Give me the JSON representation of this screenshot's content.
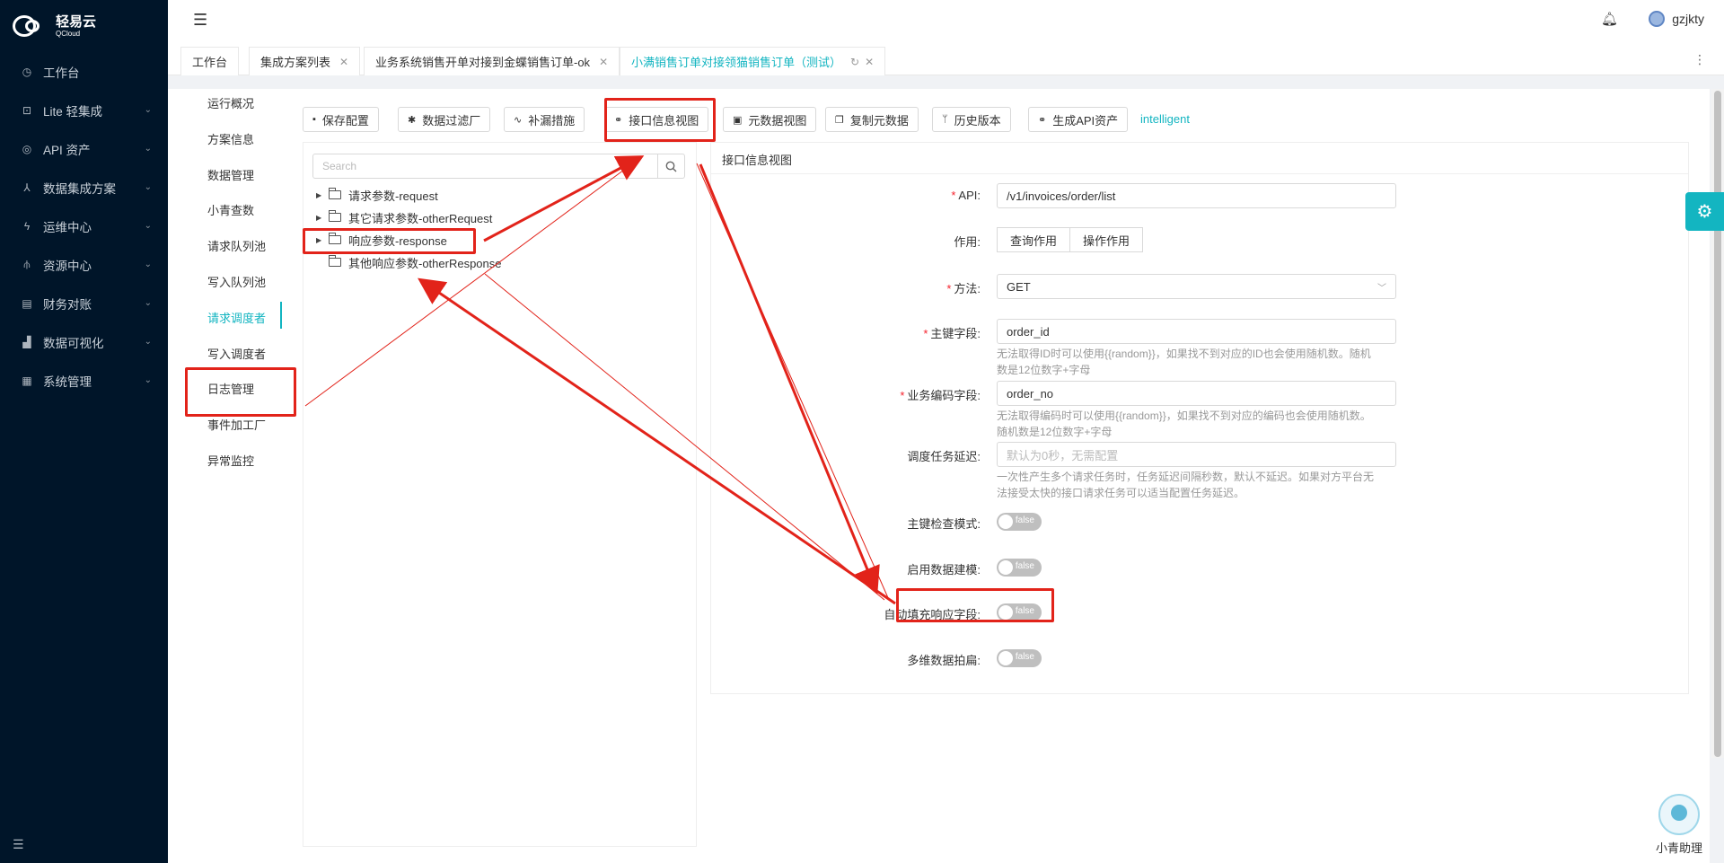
{
  "brand": {
    "name_cn": "轻易云",
    "name_en": "QCloud"
  },
  "sidebar": {
    "items": [
      {
        "label": "工作台",
        "icon": "clock-icon",
        "has_children": false
      },
      {
        "label": "Lite 轻集成",
        "icon": "lite-icon",
        "has_children": true
      },
      {
        "label": "API 资产",
        "icon": "compass-icon",
        "has_children": true
      },
      {
        "label": "数据集成方案",
        "icon": "flow-icon",
        "has_children": true
      },
      {
        "label": "运维中心",
        "icon": "bolt-icon",
        "has_children": true
      },
      {
        "label": "资源中心",
        "icon": "tree-icon",
        "has_children": true
      },
      {
        "label": "财务对账",
        "icon": "ledger-icon",
        "has_children": true
      },
      {
        "label": "数据可视化",
        "icon": "chart-icon",
        "has_children": true
      },
      {
        "label": "系统管理",
        "icon": "grid-icon",
        "has_children": true
      }
    ]
  },
  "header": {
    "username": "gzjkty"
  },
  "tabs": [
    {
      "label": "工作台",
      "closable": false,
      "active": false
    },
    {
      "label": "集成方案列表",
      "closable": true,
      "active": false
    },
    {
      "label": "业务系统销售开单对接到金蝶销售订单-ok",
      "closable": true,
      "active": false
    },
    {
      "label": "小满销售订单对接领猫销售订单（测试）",
      "closable": true,
      "active": true
    }
  ],
  "submenu": {
    "items": [
      "运行概况",
      "方案信息",
      "数据管理",
      "小青查数",
      "请求队列池",
      "写入队列池",
      "请求调度者",
      "写入调度者",
      "日志管理",
      "事件加工厂",
      "异常监控"
    ],
    "active_index": 6
  },
  "toolbar": {
    "buttons": [
      {
        "label": "保存配置",
        "icon": "save-icon"
      },
      {
        "label": "数据过滤厂",
        "icon": "gear-icon"
      },
      {
        "label": "补漏措施",
        "icon": "line-chart-icon"
      },
      {
        "label": "接口信息视图",
        "icon": "link-icon"
      },
      {
        "label": "元数据视图",
        "icon": "terminal-icon"
      },
      {
        "label": "复制元数据",
        "icon": "copy-icon"
      },
      {
        "label": "历史版本",
        "icon": "branch-icon"
      },
      {
        "label": "生成API资产",
        "icon": "link-icon"
      }
    ],
    "mode_label": "intelligent"
  },
  "tree": {
    "search_placeholder": "Search",
    "nodes": [
      {
        "label": "请求参数-request",
        "expandable": true
      },
      {
        "label": "其它请求参数-otherRequest",
        "expandable": true
      },
      {
        "label": "响应参数-response",
        "expandable": true
      },
      {
        "label": "其他响应参数-otherResponse",
        "expandable": false
      }
    ]
  },
  "form": {
    "title": "接口信息视图",
    "api": {
      "label": "API:",
      "value": "/v1/invoices/order/list"
    },
    "purpose": {
      "label": "作用:",
      "options": [
        "查询作用",
        "操作作用"
      ]
    },
    "method": {
      "label": "方法:",
      "value": "GET"
    },
    "primary_key": {
      "label": "主键字段:",
      "value": "order_id",
      "help_line1": "无法取得ID时可以使用{{random}}，如果找不到对应的ID也会使用随机数。随机",
      "help_line2": "数是12位数字+字母"
    },
    "business_code": {
      "label": "业务编码字段:",
      "value": "order_no",
      "help_line1": "无法取得编码时可以使用{{random}}，如果找不到对应的编码也会使用随机数。",
      "help_line2": "随机数是12位数字+字母"
    },
    "task_delay": {
      "label": "调度任务延迟:",
      "placeholder": "默认为0秒，无需配置",
      "help_line1": "一次性产生多个请求任务时，任务延迟间隔秒数，默认不延迟。如果对方平台无",
      "help_line2": "法接受太快的接口请求任务可以适当配置任务延迟。"
    },
    "toggles": [
      {
        "label": "主键检查模式:",
        "value": "false"
      },
      {
        "label": "启用数据建模:",
        "value": "false"
      },
      {
        "label": "自动填充响应字段:",
        "value": "false"
      },
      {
        "label": "多维数据拍扁:",
        "value": "false"
      }
    ]
  },
  "assistant": {
    "label": "小青助理"
  },
  "colors": {
    "accent": "#13b5c1",
    "sidebar_bg": "#001529",
    "annotation": "#e2231a"
  }
}
